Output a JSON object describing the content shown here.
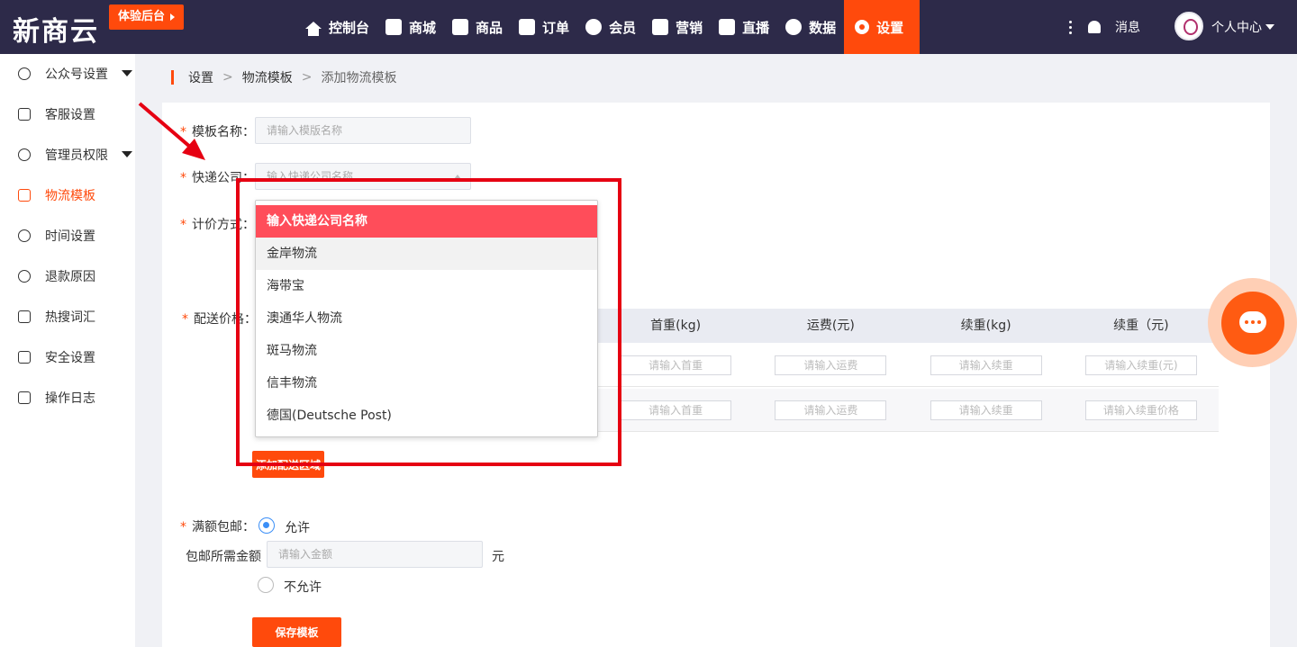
{
  "header": {
    "logo": "新商云",
    "trial_button": "体验后台",
    "nav": [
      {
        "label": "控制台",
        "icon": "home-icon"
      },
      {
        "label": "商城",
        "icon": "store-icon"
      },
      {
        "label": "商品",
        "icon": "product-icon"
      },
      {
        "label": "订单",
        "icon": "order-icon"
      },
      {
        "label": "会员",
        "icon": "member-icon"
      },
      {
        "label": "营销",
        "icon": "marketing-icon"
      },
      {
        "label": "直播",
        "icon": "live-icon"
      },
      {
        "label": "数据",
        "icon": "data-icon"
      },
      {
        "label": "设置",
        "icon": "gear-icon",
        "active": true
      }
    ],
    "messages": "消息",
    "user_center": "个人中心"
  },
  "sidebar": {
    "items": [
      {
        "label": "公众号设置",
        "icon": "link-icon",
        "has_submenu": true
      },
      {
        "label": "客服设置",
        "icon": "service-icon"
      },
      {
        "label": "管理员权限",
        "icon": "admin-icon",
        "has_submenu": true
      },
      {
        "label": "物流模板",
        "icon": "truck-icon",
        "active": true
      },
      {
        "label": "时间设置",
        "icon": "clock-icon"
      },
      {
        "label": "退款原因",
        "icon": "refund-icon"
      },
      {
        "label": "热搜词汇",
        "icon": "list-icon"
      },
      {
        "label": "安全设置",
        "icon": "lock-icon"
      },
      {
        "label": "操作日志",
        "icon": "log-icon"
      }
    ]
  },
  "breadcrumb": {
    "level1": "设置",
    "level2": "物流模板",
    "current": "添加物流模板"
  },
  "form": {
    "template_name_label": "模板名称：",
    "template_name_placeholder": "请输入模版名称",
    "express_label": "快递公司：",
    "express_placeholder": "输入快递公司名称",
    "pricing_label": "计价方式：",
    "delivery_price_label": "配送价格：",
    "table_headers": [
      "首重(kg)",
      "运费(元)",
      "续重(kg)",
      "续重（元)"
    ],
    "table_rows": [
      [
        "请输入首重",
        "请输入运费",
        "请输入续重",
        "请输入续重(元)"
      ],
      [
        "请输入首重",
        "请输入运费",
        "请输入续重",
        "请输入续重价格"
      ]
    ],
    "add_area_button": "添加配送区域",
    "free_shipping_label": "满额包邮：",
    "allow_label": "允许",
    "min_amount_label": "包邮所需金额",
    "min_amount_placeholder": "请输入金额",
    "currency_unit": "元",
    "disallow_label": "不允许",
    "save_button": "保存模板"
  },
  "dropdown": {
    "header": "输入快递公司名称",
    "options": [
      "金岸物流",
      "海带宝",
      "澳通华人物流",
      "斑马物流",
      "信丰物流",
      "德国(Deutsche Post)"
    ]
  },
  "colors": {
    "topbar": "#2d2a49",
    "accent": "#ff4a0c",
    "dropdown_header": "#ff4d5a",
    "annotation_red": "#e60012",
    "radio_blue": "#3b8ff7"
  }
}
